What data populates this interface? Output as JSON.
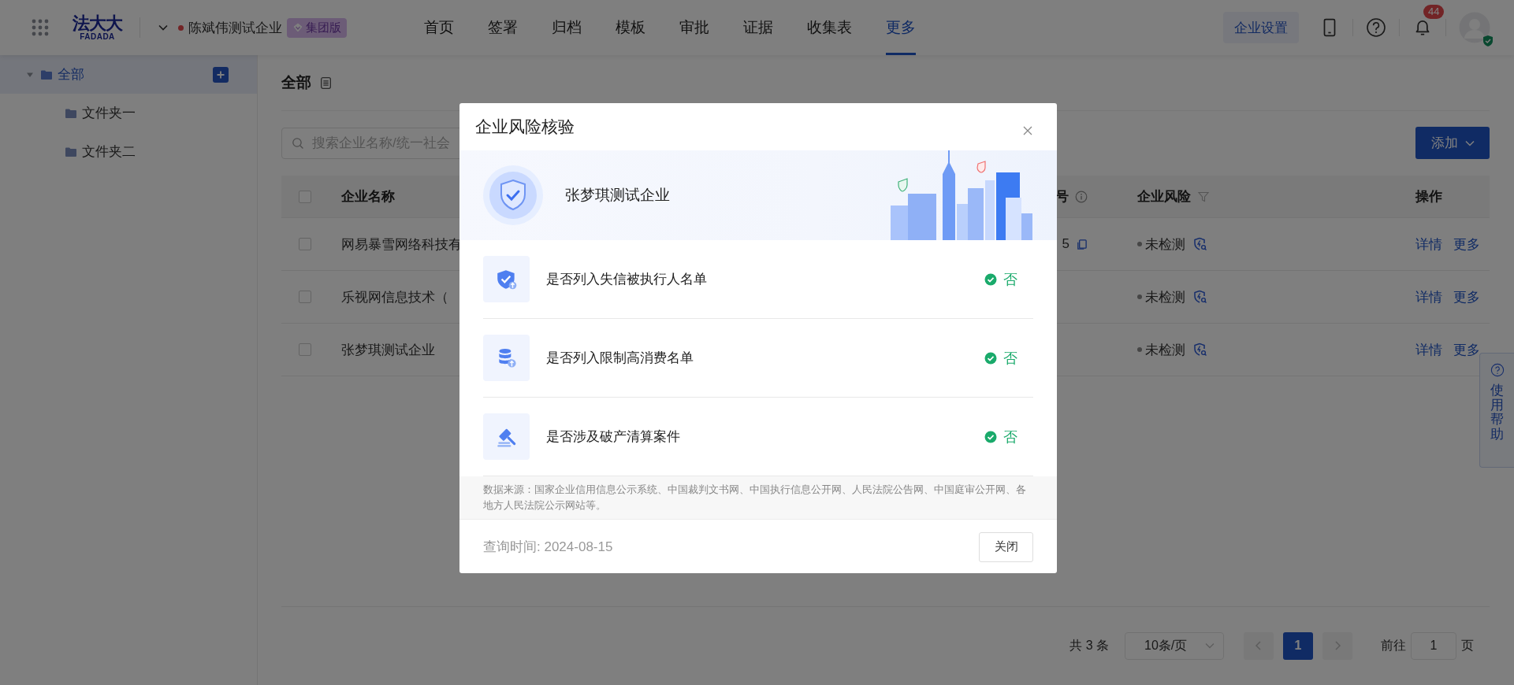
{
  "header": {
    "logo": {
      "text": "法大大",
      "subtext": "FADADA"
    },
    "company": "陈斌伟测试企业",
    "edition": "集团版",
    "nav": [
      {
        "label": "首页",
        "selected": false
      },
      {
        "label": "签署",
        "selected": false
      },
      {
        "label": "归档",
        "selected": false
      },
      {
        "label": "模板",
        "selected": false
      },
      {
        "label": "审批",
        "selected": false
      },
      {
        "label": "证据",
        "selected": false
      },
      {
        "label": "收集表",
        "selected": false
      },
      {
        "label": "更多",
        "selected": true
      }
    ],
    "settings": "企业设置",
    "notifications": "44"
  },
  "sidebar": {
    "items": [
      {
        "label": "全部",
        "selected": true,
        "expanded": true,
        "children": [
          {
            "label": "文件夹一",
            "selected": false
          },
          {
            "label": "文件夹二",
            "selected": false
          }
        ]
      }
    ]
  },
  "content": {
    "title": "全部",
    "search": {
      "placeholder": "搜索企业名称/统一社会"
    },
    "add_button": "添加"
  },
  "table": {
    "select_all": false,
    "columns": [
      {
        "label": "企业名称"
      },
      {
        "label": "号"
      },
      {
        "label": "企业风险"
      },
      {
        "label": "操作"
      }
    ],
    "rows": [
      {
        "checked": false,
        "name": "网易暴雪网络科技有",
        "code": "5",
        "risk": "未检测",
        "actions": [
          "详情",
          "更多"
        ]
      },
      {
        "checked": false,
        "name": "乐视网信息技术（",
        "risk": "未检测",
        "actions": [
          "详情",
          "更多"
        ]
      },
      {
        "checked": false,
        "name": "张梦琪测试企业",
        "risk": "未检测",
        "actions": [
          "详情",
          "更多"
        ]
      }
    ]
  },
  "pagination": {
    "total": "共 3 条",
    "page_size": "10条/页",
    "pages": [
      {
        "label": "1",
        "selected": true
      }
    ],
    "goto_label": "前往",
    "goto_value": "1",
    "goto_suffix": "页"
  },
  "help": {
    "label": "使用帮助"
  },
  "modal": {
    "title": "企业风险核验",
    "company": "张梦琪测试企业",
    "checks": [
      {
        "kind": "shield",
        "label": "是否列入失信被执行人名单",
        "result": "否",
        "passed": true
      },
      {
        "kind": "database",
        "label": "是否列入限制高消费名单",
        "result": "否",
        "passed": true
      },
      {
        "kind": "gavel",
        "label": "是否涉及破产清算案件",
        "result": "否",
        "passed": true
      }
    ],
    "source": "数据来源：国家企业信用信息公示系统、中国裁判文书网、中国执行信息公开网、人民法院公告网、中国庭审公开网、各地方人民法院公示网站等。",
    "query_time": "查询时间: 2024-08-15",
    "close_button": "关闭"
  }
}
